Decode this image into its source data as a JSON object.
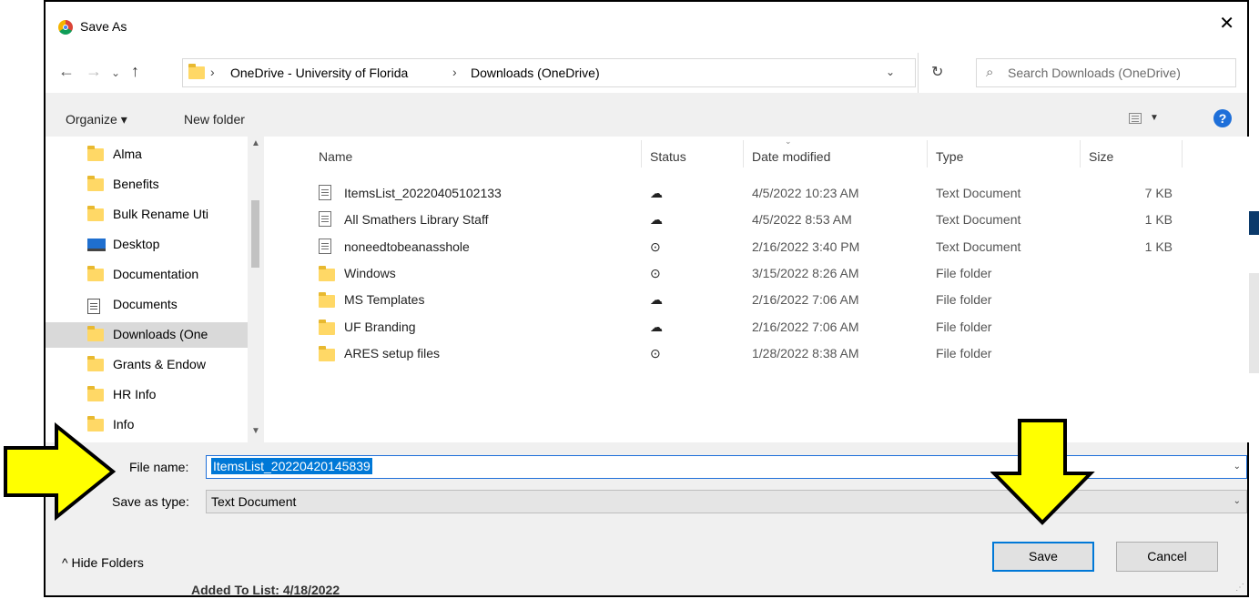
{
  "dialog": {
    "title": "Save As",
    "close_glyph": "✕"
  },
  "nav": {
    "back_glyph": "←",
    "forward_glyph": "→",
    "recent_glyph": "⌄",
    "up_glyph": "↑",
    "breadcrumbs": [
      "OneDrive - University of Florida",
      "Downloads (OneDrive)"
    ],
    "sep_glyph": "›",
    "dropdown_glyph": "⌄",
    "refresh_glyph": "↻",
    "search_placeholder": "Search Downloads (OneDrive)",
    "search_glyph": "⌕"
  },
  "toolbar": {
    "organize": "Organize ▾",
    "new_folder": "New folder",
    "help": "?"
  },
  "sidebar": {
    "items": [
      {
        "label": "Alma",
        "icon": "folder-icon"
      },
      {
        "label": "Benefits",
        "icon": "folder-icon"
      },
      {
        "label": "Bulk Rename Uti",
        "icon": "folder-icon"
      },
      {
        "label": "Desktop",
        "icon": "desktop-icon"
      },
      {
        "label": "Documentation",
        "icon": "folder-icon"
      },
      {
        "label": "Documents",
        "icon": "documents-icon"
      },
      {
        "label": "Downloads (One",
        "icon": "folder-icon",
        "selected": true
      },
      {
        "label": "Grants & Endow",
        "icon": "folder-icon"
      },
      {
        "label": "HR Info",
        "icon": "folder-icon"
      },
      {
        "label": "Info",
        "icon": "folder-icon"
      }
    ]
  },
  "files": {
    "columns": [
      "Name",
      "Status",
      "Date modified",
      "Type",
      "Size"
    ],
    "rows": [
      {
        "name": "ItemsList_20220405102133",
        "kind": "file",
        "status": "cloud",
        "date": "4/5/2022 10:23 AM",
        "type": "Text Document",
        "size": "7 KB"
      },
      {
        "name": "All Smathers Library Staff",
        "kind": "file",
        "status": "cloud",
        "date": "4/5/2022 8:53 AM",
        "type": "Text Document",
        "size": "1 KB"
      },
      {
        "name": "noneedtobeanasshole",
        "kind": "file",
        "status": "synced",
        "date": "2/16/2022 3:40 PM",
        "type": "Text Document",
        "size": "1 KB"
      },
      {
        "name": "Windows",
        "kind": "folder",
        "status": "synced",
        "date": "3/15/2022 8:26 AM",
        "type": "File folder",
        "size": ""
      },
      {
        "name": "MS Templates",
        "kind": "folder",
        "status": "cloud",
        "date": "2/16/2022 7:06 AM",
        "type": "File folder",
        "size": ""
      },
      {
        "name": "UF Branding",
        "kind": "folder",
        "status": "cloud",
        "date": "2/16/2022 7:06 AM",
        "type": "File folder",
        "size": ""
      },
      {
        "name": "ARES setup files",
        "kind": "folder",
        "status": "synced",
        "date": "1/28/2022 8:38 AM",
        "type": "File folder",
        "size": ""
      }
    ],
    "status_glyphs": {
      "cloud": "☁",
      "synced": "⊙"
    }
  },
  "form": {
    "file_name_label": "File name:",
    "file_name_value": "ItemsList_20220420145839",
    "save_type_label": "Save as type:",
    "save_type_value": "Text Document",
    "chevron": "⌄"
  },
  "footer": {
    "hide_folders": "^  Hide Folders",
    "save": "Save",
    "cancel": "Cancel"
  },
  "background": {
    "bottom_text": "Added To List: 4/18/2022"
  },
  "colors": {
    "accent": "#0078d7",
    "arrow_fill": "#ffff00"
  }
}
